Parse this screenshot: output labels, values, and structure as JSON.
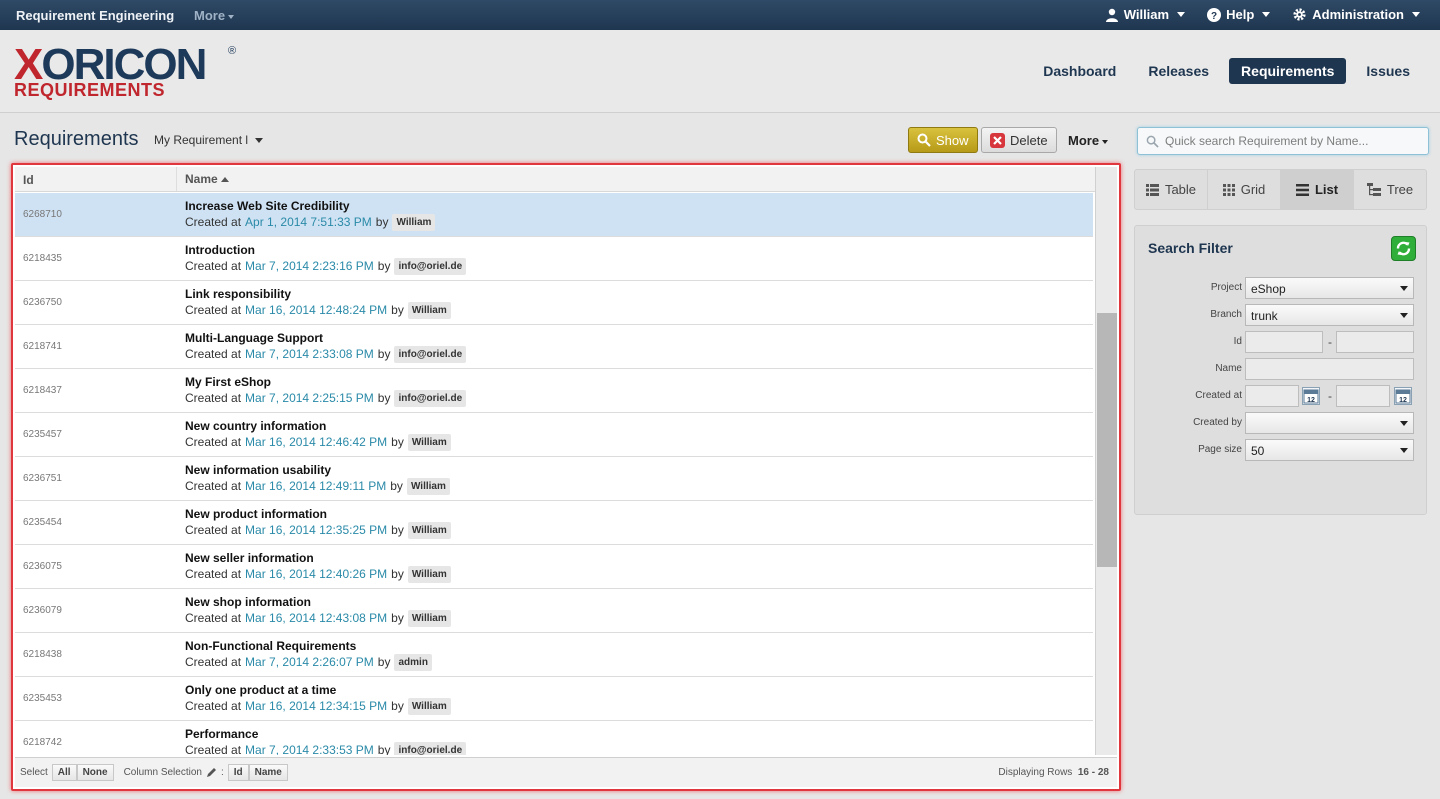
{
  "topbar": {
    "app_title": "Requirement Engineering",
    "more": "More",
    "user": "William",
    "help": "Help",
    "admin": "Administration"
  },
  "logo": {
    "word_x": "X",
    "word_rest": "ORICON",
    "reg": "®",
    "sub": "REQUIREMENTS"
  },
  "nav": [
    {
      "label": "Dashboard",
      "active": false
    },
    {
      "label": "Releases",
      "active": false
    },
    {
      "label": "Requirements",
      "active": true
    },
    {
      "label": "Issues",
      "active": false
    }
  ],
  "toolbar": {
    "title": "Requirements",
    "view_select": "My Requirement l",
    "show": "Show",
    "delete": "Delete",
    "more": "More",
    "search_placeholder": "Quick search Requirement by Name..."
  },
  "table": {
    "col_id": "Id",
    "col_name": "Name",
    "created_at_label": "Created at",
    "by_label": "by",
    "rows": [
      {
        "id": "6268710",
        "name": "Increase Web Site Credibility",
        "date": "Apr 1, 2014 7:51:33 PM",
        "user": "William",
        "selected": true
      },
      {
        "id": "6218435",
        "name": "Introduction",
        "date": "Mar 7, 2014 2:23:16 PM",
        "user": "info@oriel.de"
      },
      {
        "id": "6236750",
        "name": "Link responsibility",
        "date": "Mar 16, 2014 12:48:24 PM",
        "user": "William"
      },
      {
        "id": "6218741",
        "name": "Multi-Language Support",
        "date": "Mar 7, 2014 2:33:08 PM",
        "user": "info@oriel.de"
      },
      {
        "id": "6218437",
        "name": "My First eShop",
        "date": "Mar 7, 2014 2:25:15 PM",
        "user": "info@oriel.de"
      },
      {
        "id": "6235457",
        "name": "New country information",
        "date": "Mar 16, 2014 12:46:42 PM",
        "user": "William"
      },
      {
        "id": "6236751",
        "name": "New information usability",
        "date": "Mar 16, 2014 12:49:11 PM",
        "user": "William"
      },
      {
        "id": "6235454",
        "name": "New product information",
        "date": "Mar 16, 2014 12:35:25 PM",
        "user": "William"
      },
      {
        "id": "6236075",
        "name": "New seller information",
        "date": "Mar 16, 2014 12:40:26 PM",
        "user": "William"
      },
      {
        "id": "6236079",
        "name": "New shop information",
        "date": "Mar 16, 2014 12:43:08 PM",
        "user": "William"
      },
      {
        "id": "6218438",
        "name": "Non-Functional Requirements",
        "date": "Mar 7, 2014 2:26:07 PM",
        "user": "admin"
      },
      {
        "id": "6235453",
        "name": "Only one product at a time",
        "date": "Mar 16, 2014 12:34:15 PM",
        "user": "William"
      },
      {
        "id": "6218742",
        "name": "Performance",
        "date": "Mar 7, 2014 2:33:53 PM",
        "user": "info@oriel.de"
      }
    ]
  },
  "footer": {
    "select": "Select",
    "all": "All",
    "none": "None",
    "column_selection": "Column Selection",
    "col_id": "Id",
    "col_name": "Name",
    "displaying": "Displaying Rows",
    "range": "16 - 28"
  },
  "views": [
    {
      "label": "Table",
      "icon": "table-icon",
      "active": false
    },
    {
      "label": "Grid",
      "icon": "grid-icon",
      "active": false
    },
    {
      "label": "List",
      "icon": "list-icon",
      "active": true
    },
    {
      "label": "Tree",
      "icon": "tree-icon",
      "active": false
    }
  ],
  "filter": {
    "title": "Search Filter",
    "project_label": "Project",
    "project_value": "eShop",
    "branch_label": "Branch",
    "branch_value": "trunk",
    "id_label": "Id",
    "name_label": "Name",
    "created_at_label": "Created at",
    "created_by_label": "Created by",
    "created_by_value": "",
    "page_size_label": "Page size",
    "page_size_value": "50",
    "dash": "-",
    "cal_day": "12"
  },
  "colors": {
    "navy": "#1f3650",
    "brand_red": "#c0262d",
    "date_link": "#2a8aa8",
    "selected_row": "#cfe2f3",
    "show_button": "#c9ae2a",
    "refresh_green": "#2fae3a"
  }
}
